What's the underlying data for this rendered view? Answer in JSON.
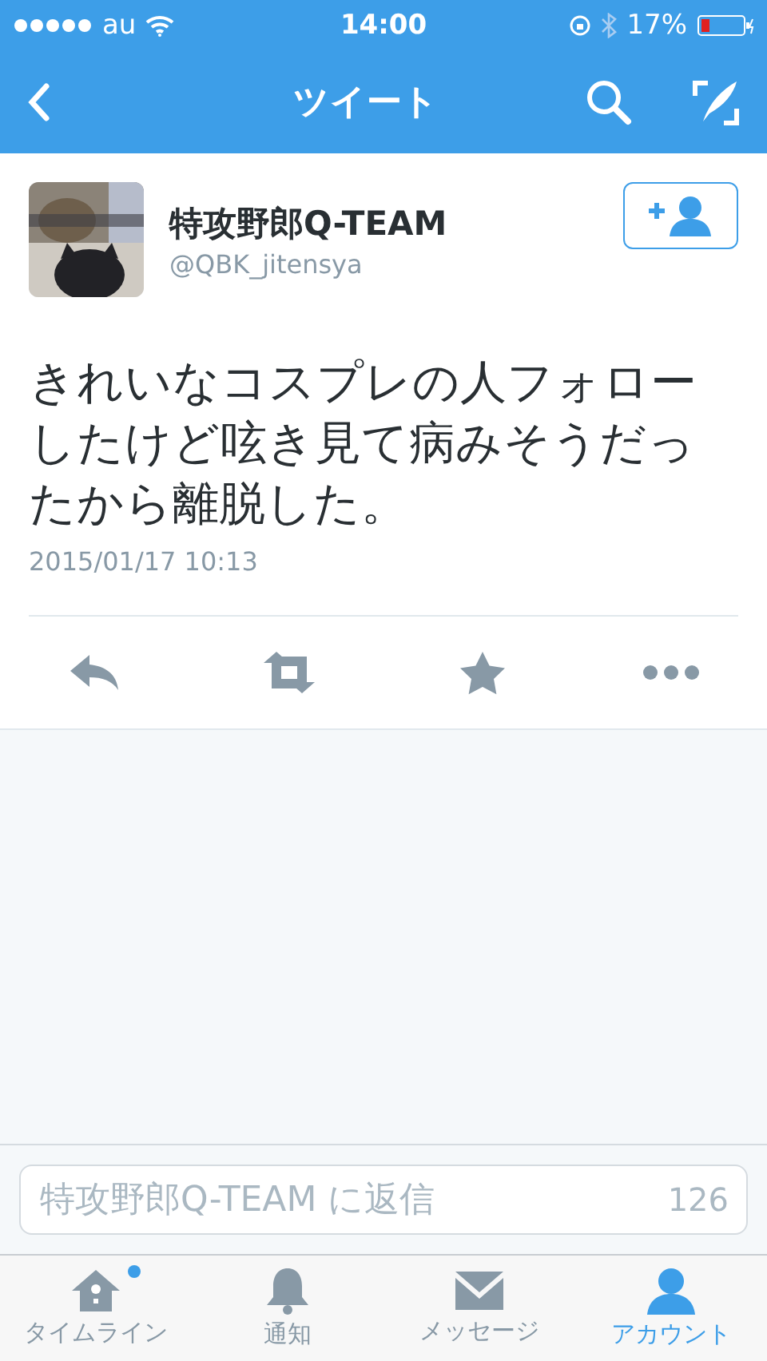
{
  "status_bar": {
    "carrier": "au",
    "time": "14:00",
    "battery": "17%"
  },
  "nav": {
    "title": "ツイート"
  },
  "tweet": {
    "name": "特攻野郎Q-TEAM",
    "handle": "@QBK_jitensya",
    "text": "きれいなコスプレの人フォローしたけど呟き見て病みそうだったから離脱した。",
    "date": "2015/01/17 10:13"
  },
  "reply": {
    "placeholder": "特攻野郎Q-TEAM に返信",
    "count": "126"
  },
  "tabs": [
    {
      "kind": "home",
      "label": "タイムライン",
      "selected": false,
      "badge": true
    },
    {
      "kind": "bell",
      "label": "通知",
      "selected": false,
      "badge": false
    },
    {
      "kind": "mail",
      "label": "メッセージ",
      "selected": false,
      "badge": false
    },
    {
      "kind": "person",
      "label": "アカウント",
      "selected": true,
      "badge": false
    }
  ]
}
